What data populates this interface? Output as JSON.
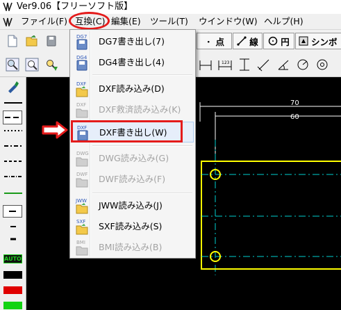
{
  "window": {
    "title": "Ver9.06【フリーソフト版】"
  },
  "menubar": {
    "items": [
      {
        "label": "ファイル(F)"
      },
      {
        "label": "互換(C)"
      },
      {
        "label": "編集(E)"
      },
      {
        "label": "ツール(T)"
      },
      {
        "label": "ウインドウ(W)"
      },
      {
        "label": "ヘルプ(H)"
      }
    ]
  },
  "toolbar": {
    "point_label": "点",
    "line_label": "線",
    "circle_label": "円",
    "symbol_label": "シンボ"
  },
  "palette": {
    "auto_label": "AUTO"
  },
  "canvas": {
    "dim_top": "70",
    "dim_second": "60"
  },
  "dropdown": {
    "items": [
      {
        "icon_text": "DG7",
        "label": "DG7書き出し(7)",
        "enabled": true
      },
      {
        "icon_text": "DG4",
        "label": "DG4書き出し(4)",
        "enabled": true
      },
      {
        "icon_text": "DXF",
        "label": "DXF読み込み(D)",
        "enabled": true
      },
      {
        "icon_text": "DXF",
        "label": "DXF救済読み込み(K)",
        "enabled": false
      },
      {
        "icon_text": "DXF",
        "label": "DXF書き出し(W)",
        "enabled": true,
        "highlighted": true
      },
      {
        "icon_text": "DWG",
        "label": "DWG読み込み(G)",
        "enabled": false
      },
      {
        "icon_text": "DWF",
        "label": "DWF読み込み(F)",
        "enabled": false
      },
      {
        "icon_text": "JWW",
        "label": "JWW読み込み(J)",
        "enabled": true
      },
      {
        "icon_text": "SXF",
        "label": "SXF読み込み(S)",
        "enabled": true
      },
      {
        "icon_text": "BMI",
        "label": "BMI読み込み(B)",
        "enabled": false
      }
    ]
  },
  "colors": {
    "annotation_red": "#e41b1b",
    "highlight": "#e6eefa",
    "cad_yellow": "#ffff00",
    "cad_cyan": "#00d0d0"
  }
}
